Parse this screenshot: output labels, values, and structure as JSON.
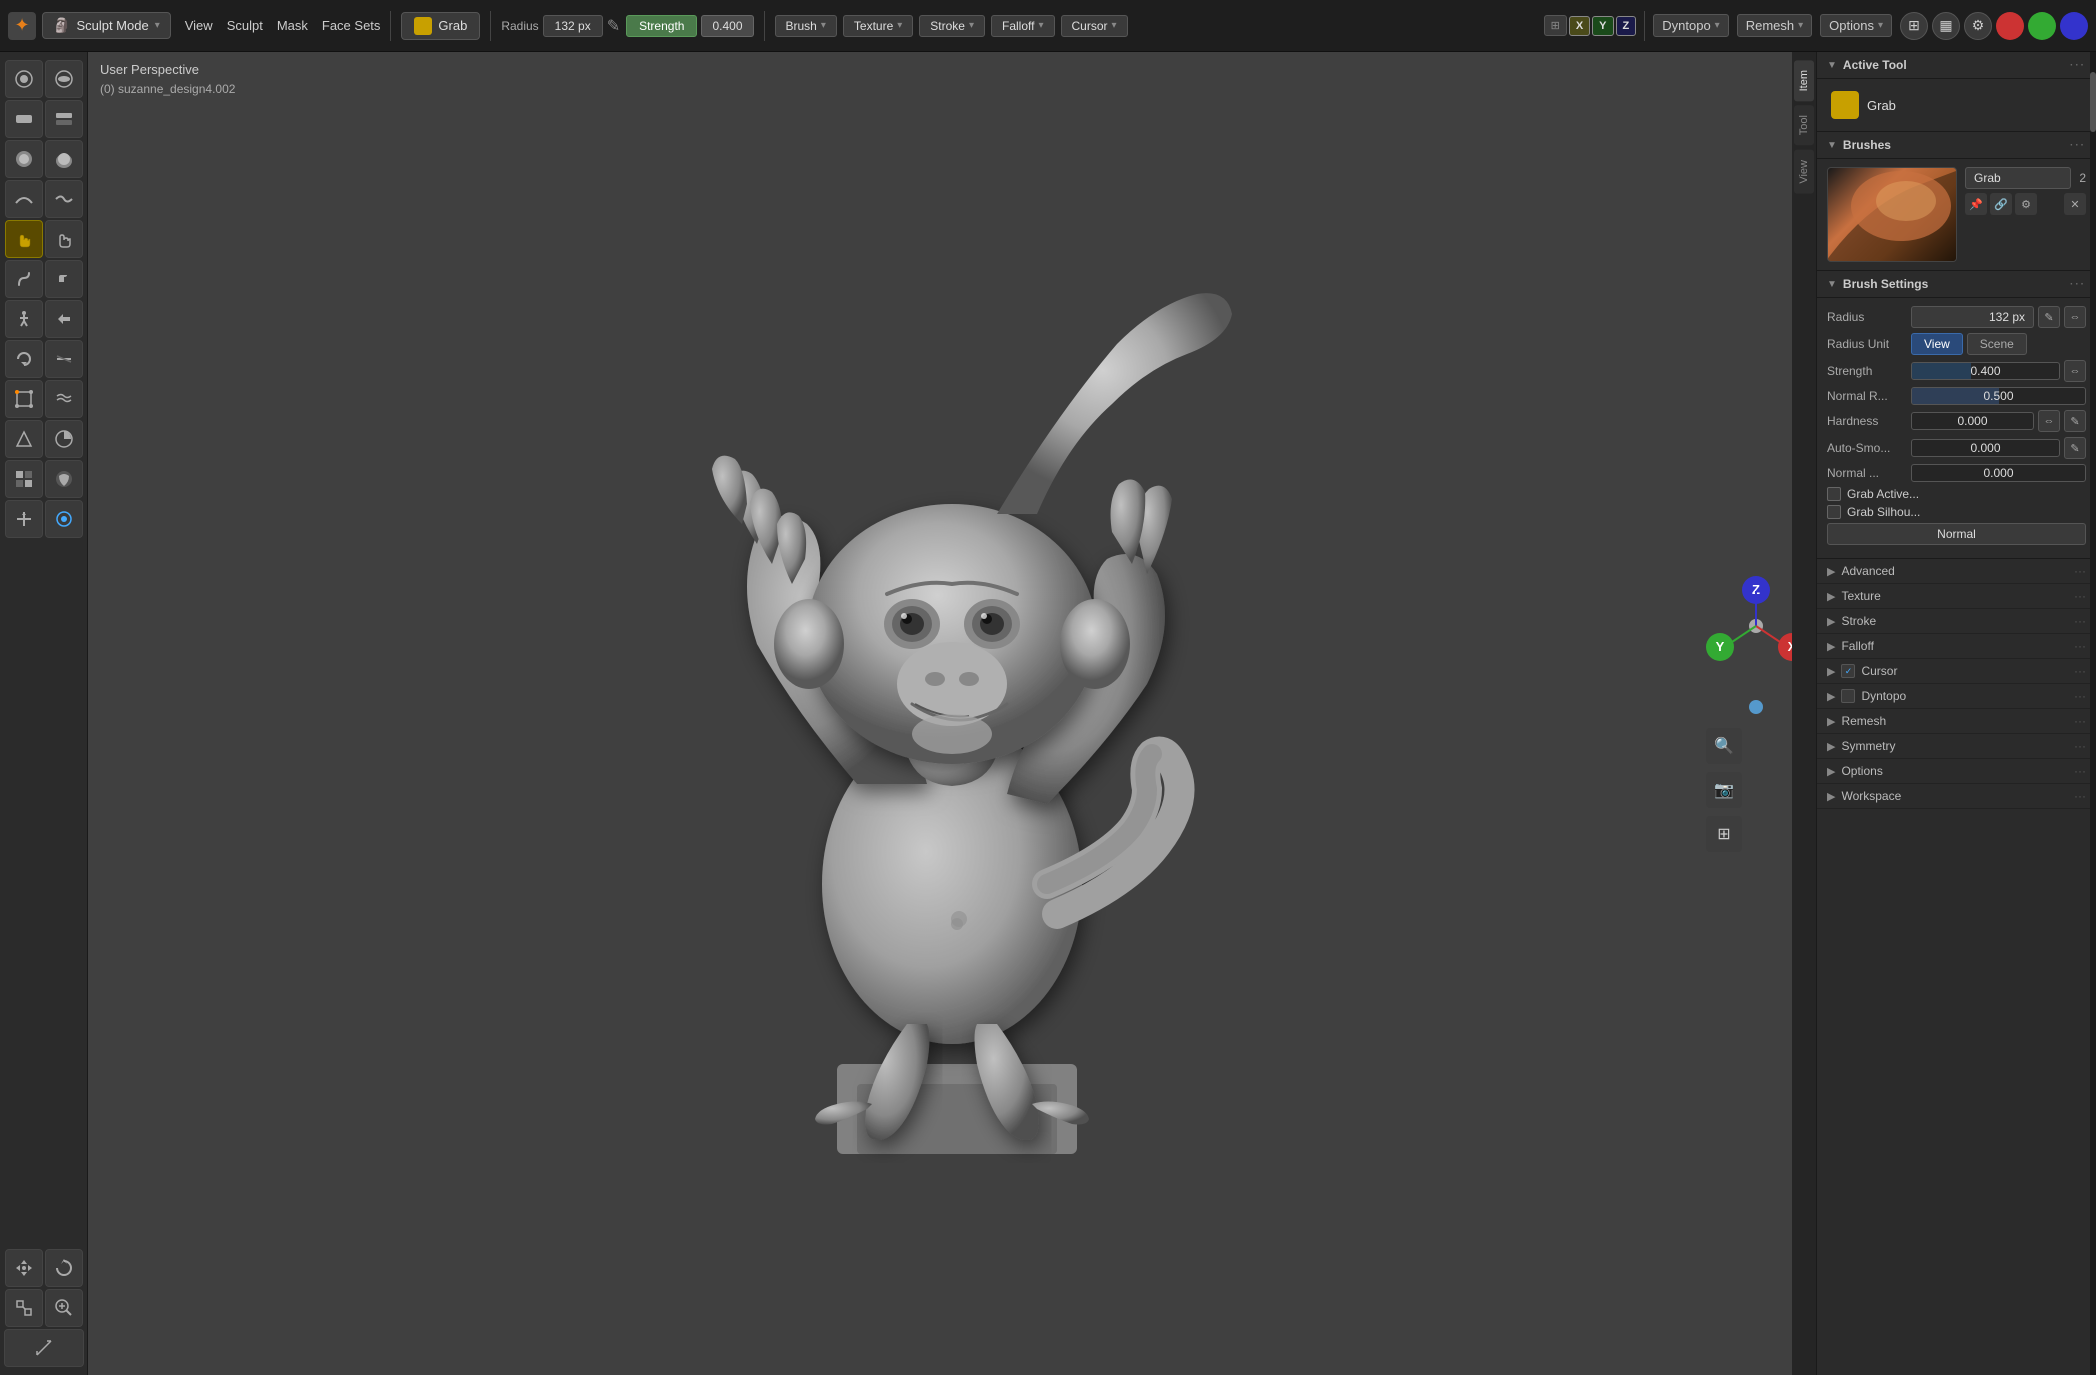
{
  "topbar": {
    "mode_icon": "✦",
    "sculpt_mode": "Sculpt Mode",
    "menu_items": [
      "View",
      "Sculpt",
      "Mask",
      "Face Sets"
    ],
    "tool_name": "Grab",
    "radius_label": "Radius",
    "radius_value": "132 px",
    "strength_label": "Strength",
    "strength_value": "0.400",
    "dropdowns": [
      "Brush",
      "Texture",
      "Stroke",
      "Falloff",
      "Cursor"
    ],
    "xyz_labels": [
      "X",
      "Y",
      "Z"
    ],
    "right_buttons": [
      "Dyntopo",
      "Remesh",
      "Options"
    ]
  },
  "viewport": {
    "perspective": "User Perspective",
    "object_info": "(0) suzanne_design4.002"
  },
  "right_panel": {
    "active_tool": {
      "header": "Active Tool",
      "tool_name": "Grab"
    },
    "brushes": {
      "header": "Brushes",
      "brush_name": "Grab",
      "brush_number": "2"
    },
    "brush_settings": {
      "header": "Brush Settings",
      "radius_label": "Radius",
      "radius_value": "132 px",
      "radius_unit_label": "Radius Unit",
      "radius_unit_view": "View",
      "radius_unit_scene": "Scene",
      "strength_label": "Strength",
      "strength_value": "0.400",
      "normal_r_label": "Normal R...",
      "normal_r_value": "0.500",
      "hardness_label": "Hardness",
      "hardness_value": "0.000",
      "auto_smooth_label": "Auto-Smo...",
      "auto_smooth_value": "0.000",
      "normal_label": "Normal ...",
      "normal_value": "0.000",
      "grab_active_label": "Grab Active...",
      "grab_silhouette_label": "Grab Silhou..."
    },
    "sections": {
      "advanced": "Advanced",
      "texture": "Texture",
      "stroke": "Stroke",
      "falloff": "Falloff",
      "cursor": "Cursor",
      "cursor_checked": true,
      "dyntopo": "Dyntopo",
      "remesh": "Remesh",
      "symmetry": "Symmetry",
      "options": "Options",
      "workspace": "Workspace"
    },
    "normal_mode": "Normal"
  },
  "left_tools": [
    {
      "icon": "◎",
      "icon2": "⊙"
    },
    {
      "icon": "↕",
      "icon2": "↔"
    },
    {
      "icon": "○",
      "icon2": "●"
    },
    {
      "icon": "≋",
      "icon2": "≈"
    },
    {
      "icon": "✦",
      "icon2": "✧"
    },
    {
      "icon": "⟳",
      "icon2": "⟲"
    },
    {
      "icon": "▷",
      "icon2": "◁"
    },
    {
      "icon": "⊕",
      "icon2": "⊗"
    },
    {
      "icon": "◈",
      "icon2": "◉"
    },
    {
      "icon": "⊞",
      "icon2": "⊟"
    },
    {
      "icon": "⊡",
      "icon2": "⊠"
    },
    {
      "icon": "↗",
      "icon2": "↙"
    },
    {
      "icon": "⊹",
      "icon2": "✦"
    },
    {
      "icon": "⊼",
      "icon2": "⊻"
    },
    {
      "icon": "⟡",
      "icon2": "⟢"
    },
    {
      "icon": "⊿",
      "icon2": "△"
    },
    {
      "icon": "⬡",
      "icon2": "⬢"
    },
    {
      "icon": "⊜",
      "icon2": "⊝"
    },
    {
      "icon": "⟨",
      "icon2": "⟩"
    },
    {
      "icon": "⊞",
      "icon2": "⊟"
    },
    {
      "icon": "⊡",
      "icon2": "⊠"
    },
    {
      "icon": "⊕",
      "icon2": "⊗"
    },
    {
      "icon": "⟳",
      "icon2": "⟲"
    },
    {
      "icon": "⊹",
      "icon2": "⊺"
    },
    {
      "icon": "↑",
      "icon2": "↓"
    }
  ]
}
